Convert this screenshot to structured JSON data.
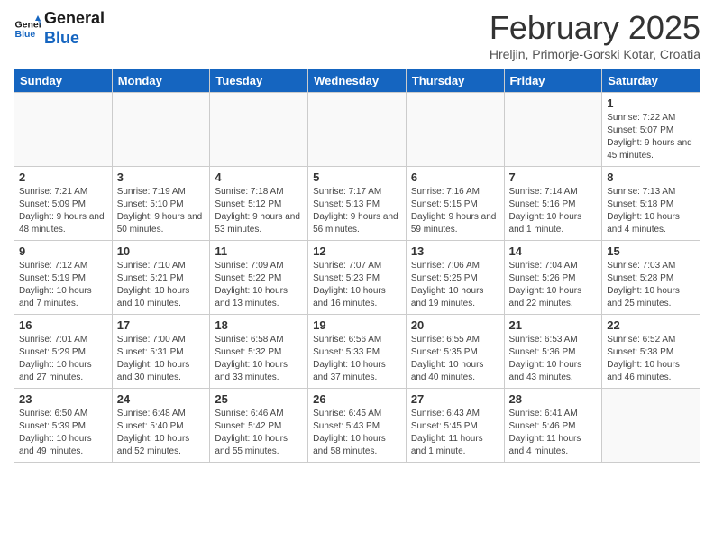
{
  "header": {
    "logo_line1": "General",
    "logo_line2": "Blue",
    "month": "February 2025",
    "location": "Hreljin, Primorje-Gorski Kotar, Croatia"
  },
  "weekdays": [
    "Sunday",
    "Monday",
    "Tuesday",
    "Wednesday",
    "Thursday",
    "Friday",
    "Saturday"
  ],
  "weeks": [
    [
      {
        "day": "",
        "info": ""
      },
      {
        "day": "",
        "info": ""
      },
      {
        "day": "",
        "info": ""
      },
      {
        "day": "",
        "info": ""
      },
      {
        "day": "",
        "info": ""
      },
      {
        "day": "",
        "info": ""
      },
      {
        "day": "1",
        "info": "Sunrise: 7:22 AM\nSunset: 5:07 PM\nDaylight: 9 hours and 45 minutes."
      }
    ],
    [
      {
        "day": "2",
        "info": "Sunrise: 7:21 AM\nSunset: 5:09 PM\nDaylight: 9 hours and 48 minutes."
      },
      {
        "day": "3",
        "info": "Sunrise: 7:19 AM\nSunset: 5:10 PM\nDaylight: 9 hours and 50 minutes."
      },
      {
        "day": "4",
        "info": "Sunrise: 7:18 AM\nSunset: 5:12 PM\nDaylight: 9 hours and 53 minutes."
      },
      {
        "day": "5",
        "info": "Sunrise: 7:17 AM\nSunset: 5:13 PM\nDaylight: 9 hours and 56 minutes."
      },
      {
        "day": "6",
        "info": "Sunrise: 7:16 AM\nSunset: 5:15 PM\nDaylight: 9 hours and 59 minutes."
      },
      {
        "day": "7",
        "info": "Sunrise: 7:14 AM\nSunset: 5:16 PM\nDaylight: 10 hours and 1 minute."
      },
      {
        "day": "8",
        "info": "Sunrise: 7:13 AM\nSunset: 5:18 PM\nDaylight: 10 hours and 4 minutes."
      }
    ],
    [
      {
        "day": "9",
        "info": "Sunrise: 7:12 AM\nSunset: 5:19 PM\nDaylight: 10 hours and 7 minutes."
      },
      {
        "day": "10",
        "info": "Sunrise: 7:10 AM\nSunset: 5:21 PM\nDaylight: 10 hours and 10 minutes."
      },
      {
        "day": "11",
        "info": "Sunrise: 7:09 AM\nSunset: 5:22 PM\nDaylight: 10 hours and 13 minutes."
      },
      {
        "day": "12",
        "info": "Sunrise: 7:07 AM\nSunset: 5:23 PM\nDaylight: 10 hours and 16 minutes."
      },
      {
        "day": "13",
        "info": "Sunrise: 7:06 AM\nSunset: 5:25 PM\nDaylight: 10 hours and 19 minutes."
      },
      {
        "day": "14",
        "info": "Sunrise: 7:04 AM\nSunset: 5:26 PM\nDaylight: 10 hours and 22 minutes."
      },
      {
        "day": "15",
        "info": "Sunrise: 7:03 AM\nSunset: 5:28 PM\nDaylight: 10 hours and 25 minutes."
      }
    ],
    [
      {
        "day": "16",
        "info": "Sunrise: 7:01 AM\nSunset: 5:29 PM\nDaylight: 10 hours and 27 minutes."
      },
      {
        "day": "17",
        "info": "Sunrise: 7:00 AM\nSunset: 5:31 PM\nDaylight: 10 hours and 30 minutes."
      },
      {
        "day": "18",
        "info": "Sunrise: 6:58 AM\nSunset: 5:32 PM\nDaylight: 10 hours and 33 minutes."
      },
      {
        "day": "19",
        "info": "Sunrise: 6:56 AM\nSunset: 5:33 PM\nDaylight: 10 hours and 37 minutes."
      },
      {
        "day": "20",
        "info": "Sunrise: 6:55 AM\nSunset: 5:35 PM\nDaylight: 10 hours and 40 minutes."
      },
      {
        "day": "21",
        "info": "Sunrise: 6:53 AM\nSunset: 5:36 PM\nDaylight: 10 hours and 43 minutes."
      },
      {
        "day": "22",
        "info": "Sunrise: 6:52 AM\nSunset: 5:38 PM\nDaylight: 10 hours and 46 minutes."
      }
    ],
    [
      {
        "day": "23",
        "info": "Sunrise: 6:50 AM\nSunset: 5:39 PM\nDaylight: 10 hours and 49 minutes."
      },
      {
        "day": "24",
        "info": "Sunrise: 6:48 AM\nSunset: 5:40 PM\nDaylight: 10 hours and 52 minutes."
      },
      {
        "day": "25",
        "info": "Sunrise: 6:46 AM\nSunset: 5:42 PM\nDaylight: 10 hours and 55 minutes."
      },
      {
        "day": "26",
        "info": "Sunrise: 6:45 AM\nSunset: 5:43 PM\nDaylight: 10 hours and 58 minutes."
      },
      {
        "day": "27",
        "info": "Sunrise: 6:43 AM\nSunset: 5:45 PM\nDaylight: 11 hours and 1 minute."
      },
      {
        "day": "28",
        "info": "Sunrise: 6:41 AM\nSunset: 5:46 PM\nDaylight: 11 hours and 4 minutes."
      },
      {
        "day": "",
        "info": ""
      }
    ]
  ]
}
